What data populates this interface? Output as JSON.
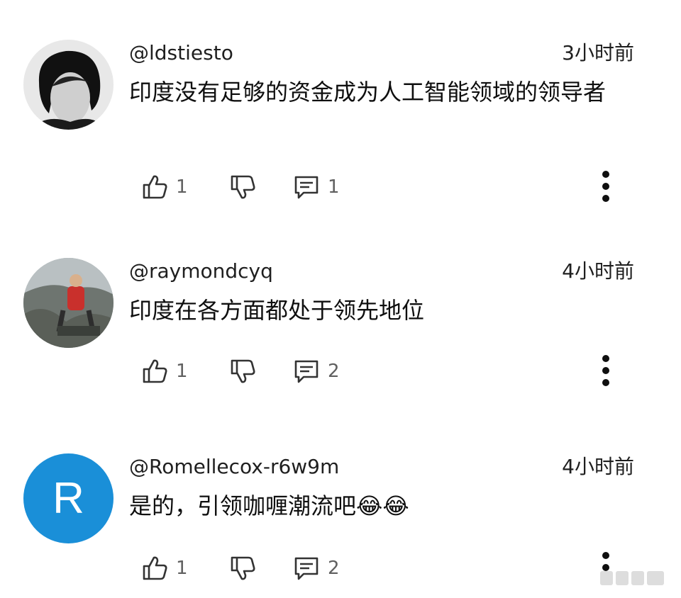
{
  "comments": [
    {
      "handle": "@ldstiesto",
      "time": "3小时前",
      "text": "印度没有足够的资金成为人工智能领域的领导者",
      "likes": "1",
      "replies": "1",
      "avatar": "photo-man-portrait"
    },
    {
      "handle": "@raymondcyq",
      "time": "4小时前",
      "text": "印度在各方面都处于领先地位",
      "likes": "1",
      "replies": "2",
      "avatar": "photo-person-outdoors"
    },
    {
      "handle": "@Romellecox-r6w9m",
      "time": "4小时前",
      "text": "是的，引领咖喱潮流吧😂😂",
      "likes": "1",
      "replies": "2",
      "avatar_letter": "R",
      "avatar_color": "#1a8fd8"
    }
  ],
  "icons": {
    "like": "thumbs-up-icon",
    "dislike": "thumbs-down-icon",
    "reply": "comment-icon",
    "more": "more-vert-icon"
  }
}
